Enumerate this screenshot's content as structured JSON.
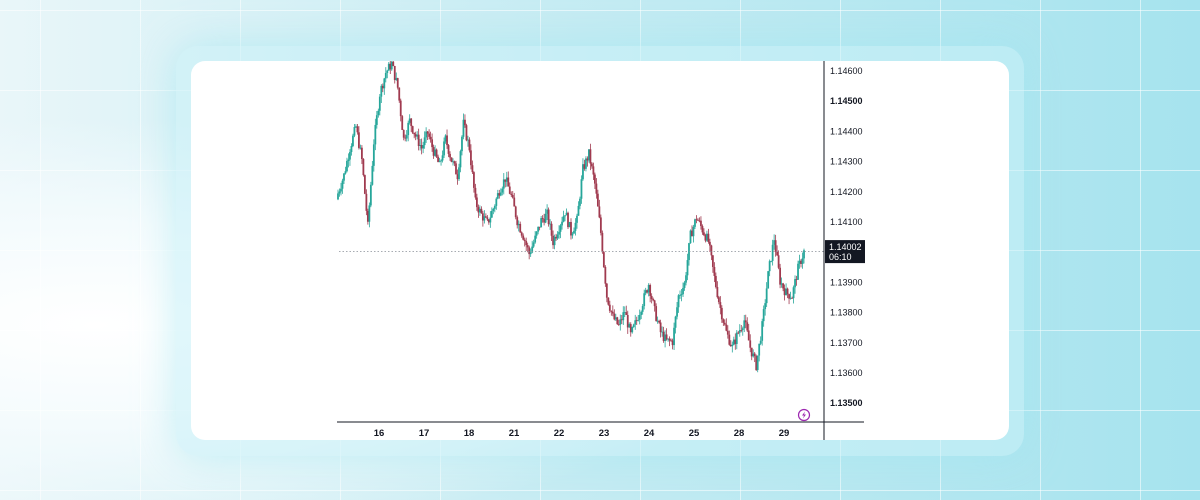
{
  "chart_data": {
    "type": "candlestick",
    "colors": {
      "up": "#26a69a",
      "down": "#a03a4f",
      "axis": "#131722",
      "current_bg": "#131722",
      "logo": "#9c27b0"
    },
    "y_ticks": [
      {
        "value": 1.146,
        "label": "1.14600",
        "bold": false
      },
      {
        "value": 1.145,
        "label": "1.14500",
        "bold": true
      },
      {
        "value": 1.144,
        "label": "1.14400",
        "bold": false
      },
      {
        "value": 1.143,
        "label": "1.14300",
        "bold": false
      },
      {
        "value": 1.142,
        "label": "1.14200",
        "bold": false
      },
      {
        "value": 1.141,
        "label": "1.14100",
        "bold": false
      },
      {
        "value": 1.139,
        "label": "1.13900",
        "bold": false
      },
      {
        "value": 1.138,
        "label": "1.13800",
        "bold": false
      },
      {
        "value": 1.137,
        "label": "1.13700",
        "bold": false
      },
      {
        "value": 1.136,
        "label": "1.13600",
        "bold": false
      },
      {
        "value": 1.135,
        "label": "1.13500",
        "bold": true
      }
    ],
    "x_ticks": [
      "16",
      "17",
      "18",
      "21",
      "22",
      "23",
      "24",
      "25",
      "28",
      "29"
    ],
    "current_price": {
      "value": 1.14002,
      "label": "1.14002",
      "countdown": "06:10"
    },
    "close_path": [
      1.14195,
      1.14255,
      1.14345,
      1.14415,
      1.14305,
      1.14085,
      1.14365,
      1.14525,
      1.14595,
      1.14625,
      1.14545,
      1.14375,
      1.14435,
      1.14385,
      1.14345,
      1.14395,
      1.14335,
      1.14285,
      1.14375,
      1.14305,
      1.14255,
      1.14425,
      1.14345,
      1.14165,
      1.14125,
      1.14095,
      1.14145,
      1.14205,
      1.14245,
      1.14185,
      1.14105,
      1.14055,
      1.13995,
      1.14045,
      1.14105,
      1.14125,
      1.14035,
      1.14085,
      1.14135,
      1.14065,
      1.14105,
      1.14275,
      1.14325,
      1.14225,
      1.14065,
      1.13855,
      1.13785,
      1.13755,
      1.13805,
      1.13725,
      1.13775,
      1.13835,
      1.13895,
      1.13805,
      1.13735,
      1.13705,
      1.13705,
      1.13855,
      1.13895,
      1.14055,
      1.14115,
      1.14075,
      1.14035,
      1.13915,
      1.13815,
      1.13735,
      1.13685,
      1.13735,
      1.13775,
      1.13685,
      1.13625,
      1.13755,
      1.13925,
      1.14045,
      1.13905,
      1.13865,
      1.13855,
      1.13945,
      1.14002
    ]
  }
}
